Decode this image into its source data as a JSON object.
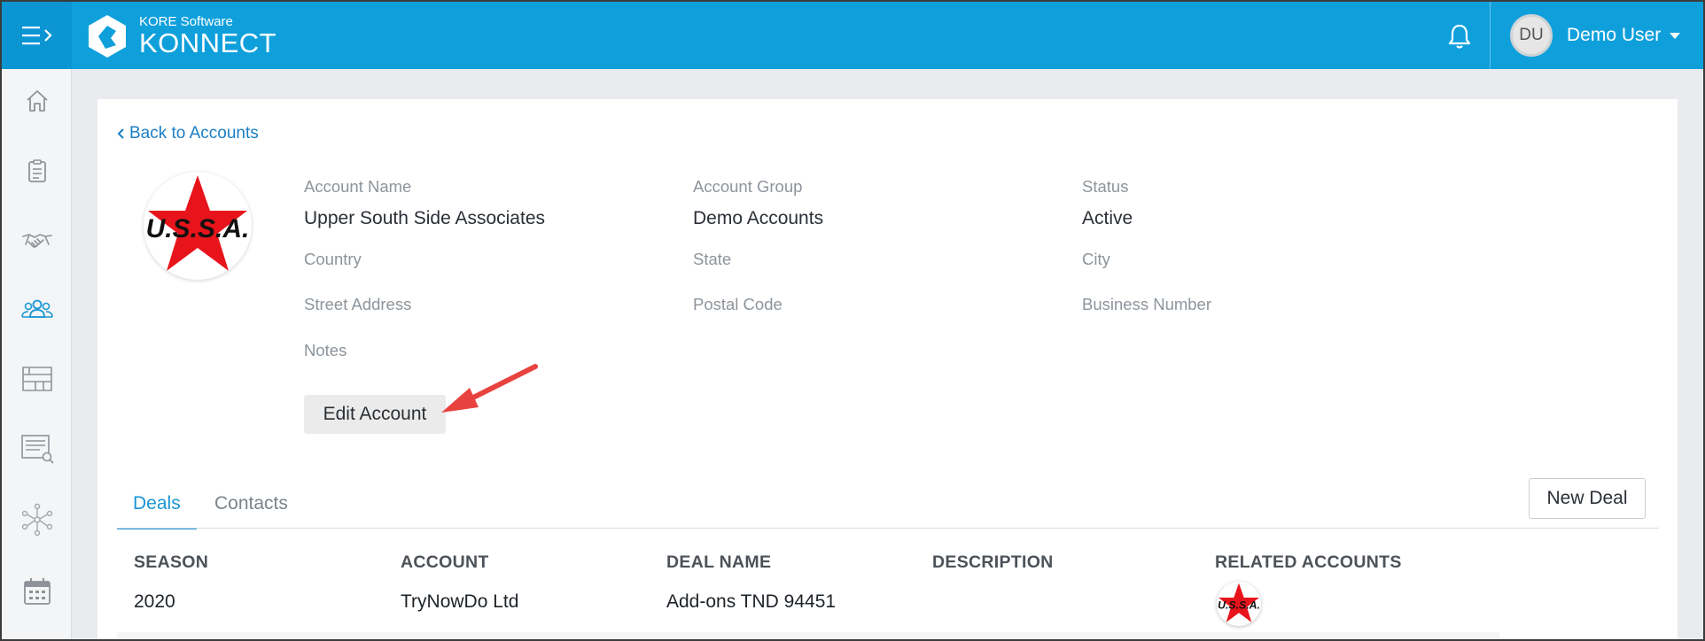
{
  "header": {
    "brand_sub": "KORE Software",
    "brand_main": "KONNECT",
    "user_initials": "DU",
    "user_name": "Demo User"
  },
  "sidebar": {
    "items": [
      {
        "icon": "home-icon"
      },
      {
        "icon": "clipboard-icon"
      },
      {
        "icon": "handshake-icon"
      },
      {
        "icon": "people-icon",
        "active": true
      },
      {
        "icon": "inventory-icon"
      },
      {
        "icon": "report-search-icon"
      },
      {
        "icon": "network-icon"
      },
      {
        "icon": "calendar-icon"
      }
    ]
  },
  "back_link": "Back to Accounts",
  "account": {
    "logo_text": "U.S.S.A.",
    "fields": {
      "account_name_label": "Account Name",
      "account_name_value": "Upper South Side Associates",
      "account_group_label": "Account Group",
      "account_group_value": "Demo Accounts",
      "status_label": "Status",
      "status_value": "Active",
      "country_label": "Country",
      "state_label": "State",
      "city_label": "City",
      "street_label": "Street Address",
      "postal_label": "Postal Code",
      "business_label": "Business Number",
      "notes_label": "Notes"
    },
    "edit_button": "Edit Account"
  },
  "tabs": [
    "Deals",
    "Contacts"
  ],
  "new_deal_button": "New Deal",
  "table": {
    "columns": [
      "SEASON",
      "ACCOUNT",
      "DEAL NAME",
      "DESCRIPTION",
      "RELATED ACCOUNTS"
    ],
    "rows": [
      {
        "season": "2020",
        "account": "TryNowDo Ltd",
        "deal_name": "Add-ons TND 94451",
        "description": "",
        "related_logo": "U.S.S.A."
      }
    ]
  },
  "colors": {
    "topbar": "#0fa0dc",
    "accent": "#1a96d4",
    "link": "#1c7fc4",
    "arrow": "#e8423f",
    "star": "#e8141b"
  }
}
